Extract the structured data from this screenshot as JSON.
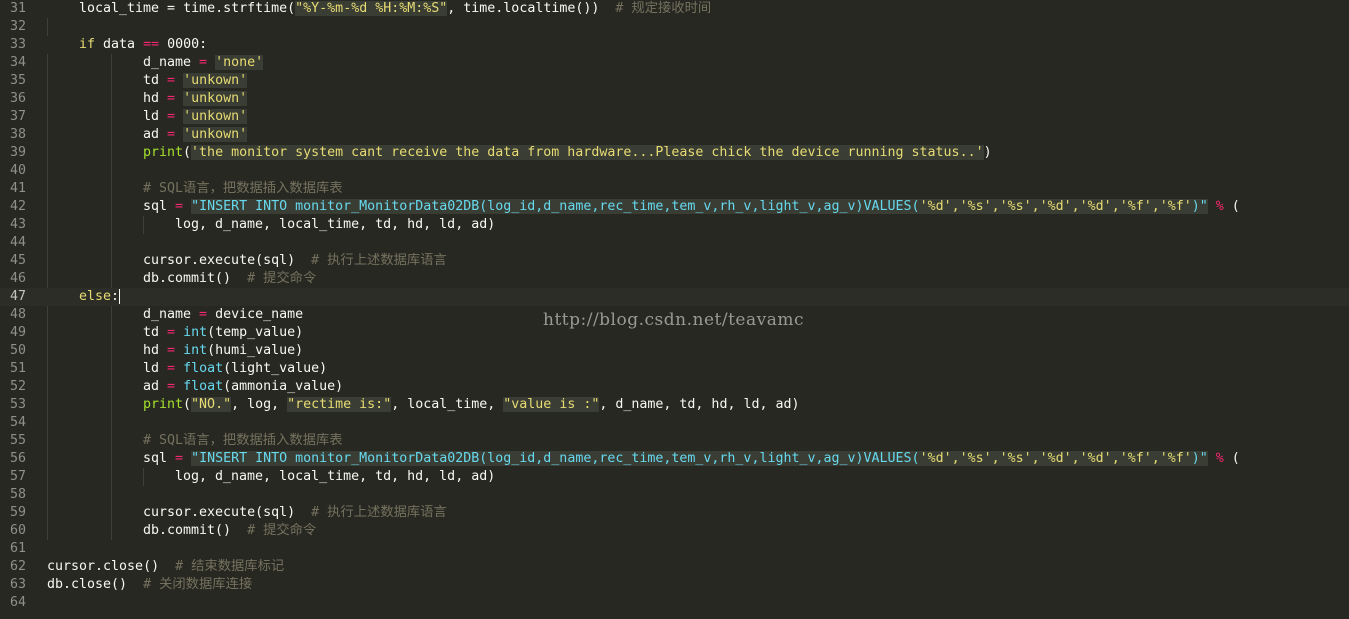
{
  "editor": {
    "theme": "monokai",
    "colors": {
      "background": "#272822",
      "foreground": "#f8f8f2",
      "keyword": "#f92672",
      "string": "#e6db74",
      "function": "#66d9ef",
      "comment": "#75715e",
      "number": "#ae81ff",
      "line_number": "#8f908a"
    },
    "current_line": 47,
    "lines": [
      {
        "n": "31",
        "indent": 1,
        "tokens": [
          {
            "t": "local_time = time.strftime(",
            "c": "plain"
          },
          {
            "t": "\"%Y-%m-%d %H:%M:%S\"",
            "c": "str"
          },
          {
            "t": ", time.localtime())  ",
            "c": "plain"
          },
          {
            "t": "# 规定接收时间",
            "c": "cmt"
          }
        ]
      },
      {
        "n": "32",
        "indent": 0,
        "tokens": []
      },
      {
        "n": "33",
        "indent": 1,
        "tokens": [
          {
            "t": "if",
            "c": "kwe"
          },
          {
            "t": " data ",
            "c": "plain"
          },
          {
            "t": "==",
            "c": "op"
          },
          {
            "t": " 0000:",
            "c": "plain"
          }
        ]
      },
      {
        "n": "34",
        "indent": 3,
        "tokens": [
          {
            "t": "d_name ",
            "c": "plain"
          },
          {
            "t": "=",
            "c": "op"
          },
          {
            "t": " ",
            "c": "plain"
          },
          {
            "t": "'none'",
            "c": "str"
          }
        ]
      },
      {
        "n": "35",
        "indent": 3,
        "tokens": [
          {
            "t": "td ",
            "c": "plain"
          },
          {
            "t": "=",
            "c": "op"
          },
          {
            "t": " ",
            "c": "plain"
          },
          {
            "t": "'unkown'",
            "c": "str"
          }
        ]
      },
      {
        "n": "36",
        "indent": 3,
        "tokens": [
          {
            "t": "hd ",
            "c": "plain"
          },
          {
            "t": "=",
            "c": "op"
          },
          {
            "t": " ",
            "c": "plain"
          },
          {
            "t": "'unkown'",
            "c": "str"
          }
        ]
      },
      {
        "n": "37",
        "indent": 3,
        "tokens": [
          {
            "t": "ld ",
            "c": "plain"
          },
          {
            "t": "=",
            "c": "op"
          },
          {
            "t": " ",
            "c": "plain"
          },
          {
            "t": "'unkown'",
            "c": "str"
          }
        ]
      },
      {
        "n": "38",
        "indent": 3,
        "tokens": [
          {
            "t": "ad ",
            "c": "plain"
          },
          {
            "t": "=",
            "c": "op"
          },
          {
            "t": " ",
            "c": "plain"
          },
          {
            "t": "'unkown'",
            "c": "str"
          }
        ]
      },
      {
        "n": "39",
        "indent": 3,
        "tokens": [
          {
            "t": "print",
            "c": "bi"
          },
          {
            "t": "(",
            "c": "plain"
          },
          {
            "t": "'the monitor system cant receive the data from hardware...Please chick the device running status..'",
            "c": "str"
          },
          {
            "t": ")",
            "c": "plain"
          }
        ]
      },
      {
        "n": "40",
        "indent": 0,
        "tokens": []
      },
      {
        "n": "41",
        "indent": 3,
        "tokens": [
          {
            "t": "# SQL语言，把数据插入数据库表",
            "c": "cmt"
          }
        ]
      },
      {
        "n": "42",
        "indent": 3,
        "tokens": [
          {
            "t": "sql ",
            "c": "plain"
          },
          {
            "t": "=",
            "c": "op"
          },
          {
            "t": " ",
            "c": "plain"
          },
          {
            "t": "\"INSERT INTO monitor_MonitorData02DB(log_id,d_name,rec_time,tem_v,rh_v,light_v,ag_v)VALUES(",
            "c": "sql"
          },
          {
            "t": "'%d','%s','%s','%d','%d','%f','%f'",
            "c": "str"
          },
          {
            "t": ")\"",
            "c": "sql"
          },
          {
            "t": " ",
            "c": "plain"
          },
          {
            "t": "%",
            "c": "op"
          },
          {
            "t": " (",
            "c": "plain"
          }
        ]
      },
      {
        "n": "43",
        "indent": 4,
        "tokens": [
          {
            "t": "log, d_name, local_time, td, hd, ld, ad)",
            "c": "plain"
          }
        ]
      },
      {
        "n": "44",
        "indent": 0,
        "tokens": []
      },
      {
        "n": "45",
        "indent": 3,
        "tokens": [
          {
            "t": "cursor.execute(sql)  ",
            "c": "plain"
          },
          {
            "t": "# 执行上述数据库语言",
            "c": "cmt"
          }
        ]
      },
      {
        "n": "46",
        "indent": 3,
        "tokens": [
          {
            "t": "db.commit()  ",
            "c": "plain"
          },
          {
            "t": "# 提交命令",
            "c": "cmt"
          }
        ]
      },
      {
        "n": "47",
        "indent": 1,
        "tokens": [
          {
            "t": "else",
            "c": "kwe"
          },
          {
            "t": ":",
            "c": "plain"
          }
        ],
        "cursor": true
      },
      {
        "n": "48",
        "indent": 3,
        "tokens": [
          {
            "t": "d_name ",
            "c": "plain"
          },
          {
            "t": "=",
            "c": "op"
          },
          {
            "t": " device_name",
            "c": "plain"
          }
        ]
      },
      {
        "n": "49",
        "indent": 3,
        "tokens": [
          {
            "t": "td ",
            "c": "plain"
          },
          {
            "t": "=",
            "c": "op"
          },
          {
            "t": " ",
            "c": "plain"
          },
          {
            "t": "int",
            "c": "fn"
          },
          {
            "t": "(temp_value)",
            "c": "plain"
          }
        ]
      },
      {
        "n": "50",
        "indent": 3,
        "tokens": [
          {
            "t": "hd ",
            "c": "plain"
          },
          {
            "t": "=",
            "c": "op"
          },
          {
            "t": " ",
            "c": "plain"
          },
          {
            "t": "int",
            "c": "fn"
          },
          {
            "t": "(humi_value)",
            "c": "plain"
          }
        ]
      },
      {
        "n": "51",
        "indent": 3,
        "tokens": [
          {
            "t": "ld ",
            "c": "plain"
          },
          {
            "t": "=",
            "c": "op"
          },
          {
            "t": " ",
            "c": "plain"
          },
          {
            "t": "float",
            "c": "fn"
          },
          {
            "t": "(light_value)",
            "c": "plain"
          }
        ]
      },
      {
        "n": "52",
        "indent": 3,
        "tokens": [
          {
            "t": "ad ",
            "c": "plain"
          },
          {
            "t": "=",
            "c": "op"
          },
          {
            "t": " ",
            "c": "plain"
          },
          {
            "t": "float",
            "c": "fn"
          },
          {
            "t": "(ammonia_value)",
            "c": "plain"
          }
        ]
      },
      {
        "n": "53",
        "indent": 3,
        "tokens": [
          {
            "t": "print",
            "c": "bi"
          },
          {
            "t": "(",
            "c": "plain"
          },
          {
            "t": "\"NO.\"",
            "c": "str"
          },
          {
            "t": ", log, ",
            "c": "plain"
          },
          {
            "t": "\"rectime is:\"",
            "c": "str"
          },
          {
            "t": ", local_time, ",
            "c": "plain"
          },
          {
            "t": "\"value is :\"",
            "c": "str"
          },
          {
            "t": ", d_name, td, hd, ld, ad)",
            "c": "plain"
          }
        ]
      },
      {
        "n": "54",
        "indent": 0,
        "tokens": []
      },
      {
        "n": "55",
        "indent": 3,
        "tokens": [
          {
            "t": "# SQL语言，把数据插入数据库表",
            "c": "cmt"
          }
        ]
      },
      {
        "n": "56",
        "indent": 3,
        "tokens": [
          {
            "t": "sql ",
            "c": "plain"
          },
          {
            "t": "=",
            "c": "op"
          },
          {
            "t": " ",
            "c": "plain"
          },
          {
            "t": "\"INSERT INTO monitor_MonitorData02DB(log_id,d_name,rec_time,tem_v,rh_v,light_v,ag_v)VALUES(",
            "c": "sql"
          },
          {
            "t": "'%d','%s','%s','%d','%d','%f','%f'",
            "c": "str"
          },
          {
            "t": ")\"",
            "c": "sql"
          },
          {
            "t": " ",
            "c": "plain"
          },
          {
            "t": "%",
            "c": "op"
          },
          {
            "t": " (",
            "c": "plain"
          }
        ]
      },
      {
        "n": "57",
        "indent": 4,
        "tokens": [
          {
            "t": "log, d_name, local_time, td, hd, ld, ad)",
            "c": "plain"
          }
        ]
      },
      {
        "n": "58",
        "indent": 0,
        "tokens": []
      },
      {
        "n": "59",
        "indent": 3,
        "tokens": [
          {
            "t": "cursor.execute(sql)  ",
            "c": "plain"
          },
          {
            "t": "# 执行上述数据库语言",
            "c": "cmt"
          }
        ]
      },
      {
        "n": "60",
        "indent": 3,
        "tokens": [
          {
            "t": "db.commit()  ",
            "c": "plain"
          },
          {
            "t": "# 提交命令",
            "c": "cmt"
          }
        ]
      },
      {
        "n": "61",
        "indent": 0,
        "tokens": []
      },
      {
        "n": "62",
        "indent": 0,
        "tokens": [
          {
            "t": "cursor.close()  ",
            "c": "plain"
          },
          {
            "t": "# 结束数据库标记",
            "c": "cmt"
          }
        ]
      },
      {
        "n": "63",
        "indent": 0,
        "tokens": [
          {
            "t": "db.close()  ",
            "c": "plain"
          },
          {
            "t": "# 关闭数据库连接",
            "c": "cmt"
          }
        ]
      },
      {
        "n": "64",
        "indent": 0,
        "tokens": []
      }
    ]
  },
  "watermark": "http://blog.csdn.net/teavamc"
}
